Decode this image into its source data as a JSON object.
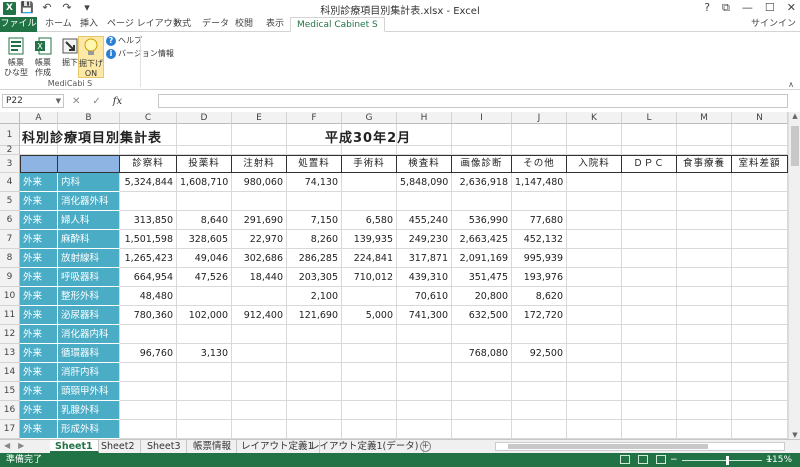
{
  "window": {
    "title": "科別診療項目別集計表.xlsx - Excel",
    "app_icon": "X",
    "help": "?",
    "restore": "⧉",
    "minimize": "—",
    "maximize": "☐",
    "close": "✕"
  },
  "qat": {
    "save": "💾",
    "undo": "↶",
    "redo": "↷",
    "customize": "▾"
  },
  "ribbon_tabs": [
    "ファイル",
    "ホーム",
    "挿入",
    "ページ レイアウト",
    "数式",
    "データ",
    "校閲",
    "表示",
    "Medical Cabinet S"
  ],
  "signin": "サインイン",
  "ribbon": {
    "buttons": [
      {
        "label": "帳票\nひな型"
      },
      {
        "label": "帳票\n作成"
      },
      {
        "label": "掘下"
      },
      {
        "label": "掘下げ\nON"
      }
    ],
    "help_label": "ヘルプ",
    "version_label": "バージョン情報",
    "group_label": "MediCabi S",
    "collapse": "∧"
  },
  "formula_bar": {
    "name_box": "P22",
    "fx": "fx",
    "cancel": "✕",
    "enter": "✓",
    "value": ""
  },
  "columns": [
    "A",
    "B",
    "C",
    "D",
    "E",
    "F",
    "G",
    "H",
    "I",
    "J",
    "K",
    "L",
    "M",
    "N"
  ],
  "rows": [
    "1",
    "2",
    "3",
    "4",
    "5",
    "6",
    "7",
    "8",
    "9",
    "10",
    "11",
    "12",
    "13",
    "14",
    "15",
    "16",
    "17"
  ],
  "sheet": {
    "title": "科別診療項目別集計表",
    "period": "平成30年2月",
    "headers": [
      "診察料",
      "投薬料",
      "注射料",
      "処置料",
      "手術料",
      "検査料",
      "画像診断",
      "その他",
      "入院料",
      "ＤＰＣ",
      "食事療養",
      "室料差額"
    ],
    "data_rows": [
      {
        "type": "外来",
        "dept": "内科",
        "values": [
          "5,324,844",
          "1,608,710",
          "980,060",
          "74,130",
          "",
          "5,848,090",
          "2,636,918",
          "1,147,480"
        ]
      },
      {
        "type": "外来",
        "dept": "消化器外科",
        "values": [
          "",
          "",
          "",
          "",
          "",
          "",
          "",
          ""
        ]
      },
      {
        "type": "外来",
        "dept": "婦人科",
        "values": [
          "313,850",
          "8,640",
          "291,690",
          "7,150",
          "6,580",
          "455,240",
          "536,990",
          "77,680"
        ]
      },
      {
        "type": "外来",
        "dept": "麻酔科",
        "values": [
          "1,501,598",
          "328,605",
          "22,970",
          "8,260",
          "139,935",
          "249,230",
          "2,663,425",
          "452,132"
        ]
      },
      {
        "type": "外来",
        "dept": "放射線科",
        "values": [
          "1,265,423",
          "49,046",
          "302,686",
          "286,285",
          "224,841",
          "317,871",
          "2,091,169",
          "995,939"
        ]
      },
      {
        "type": "外来",
        "dept": "呼吸器科",
        "values": [
          "664,954",
          "47,526",
          "18,440",
          "203,305",
          "710,012",
          "439,310",
          "351,475",
          "193,976"
        ]
      },
      {
        "type": "外来",
        "dept": "整形外科",
        "values": [
          "48,480",
          "",
          "",
          "2,100",
          "",
          "70,610",
          "20,800",
          "8,620"
        ]
      },
      {
        "type": "外来",
        "dept": "泌尿器科",
        "values": [
          "780,360",
          "102,000",
          "912,400",
          "121,690",
          "5,000",
          "741,300",
          "632,500",
          "172,720"
        ]
      },
      {
        "type": "外来",
        "dept": "消化器内科",
        "values": [
          "",
          "",
          "",
          "",
          "",
          "",
          "",
          ""
        ]
      },
      {
        "type": "外来",
        "dept": "循環器科",
        "values": [
          "96,760",
          "3,130",
          "",
          "",
          "",
          "",
          "768,080",
          "92,500"
        ]
      },
      {
        "type": "外来",
        "dept": "消肝内科",
        "values": [
          "",
          "",
          "",
          "",
          "",
          "",
          "",
          ""
        ]
      },
      {
        "type": "外来",
        "dept": "頭頸甲外科",
        "values": [
          "",
          "",
          "",
          "",
          "",
          "",
          "",
          ""
        ]
      },
      {
        "type": "外来",
        "dept": "乳腺外科",
        "values": [
          "",
          "",
          "",
          "",
          "",
          "",
          "",
          ""
        ]
      },
      {
        "type": "外来",
        "dept": "形成外科",
        "values": [
          "",
          "",
          "",
          "",
          "",
          "",
          "",
          ""
        ]
      }
    ]
  },
  "sheet_tabs": [
    "Sheet1",
    "Sheet2",
    "Sheet3",
    "帳票情報",
    "レイアウト定義1",
    "レイアウト定義1(データ)"
  ],
  "active_sheet": "Sheet1",
  "add_sheet": "+",
  "nav_arrows": [
    "◀",
    "▶"
  ],
  "status": {
    "ready": "準備完了",
    "zoom": "115%",
    "zoom_minus": "−",
    "zoom_plus": "+"
  },
  "colors": {
    "excel_green": "#217346",
    "teal": "#4bacc6",
    "header_blue": "#8db4e2"
  }
}
